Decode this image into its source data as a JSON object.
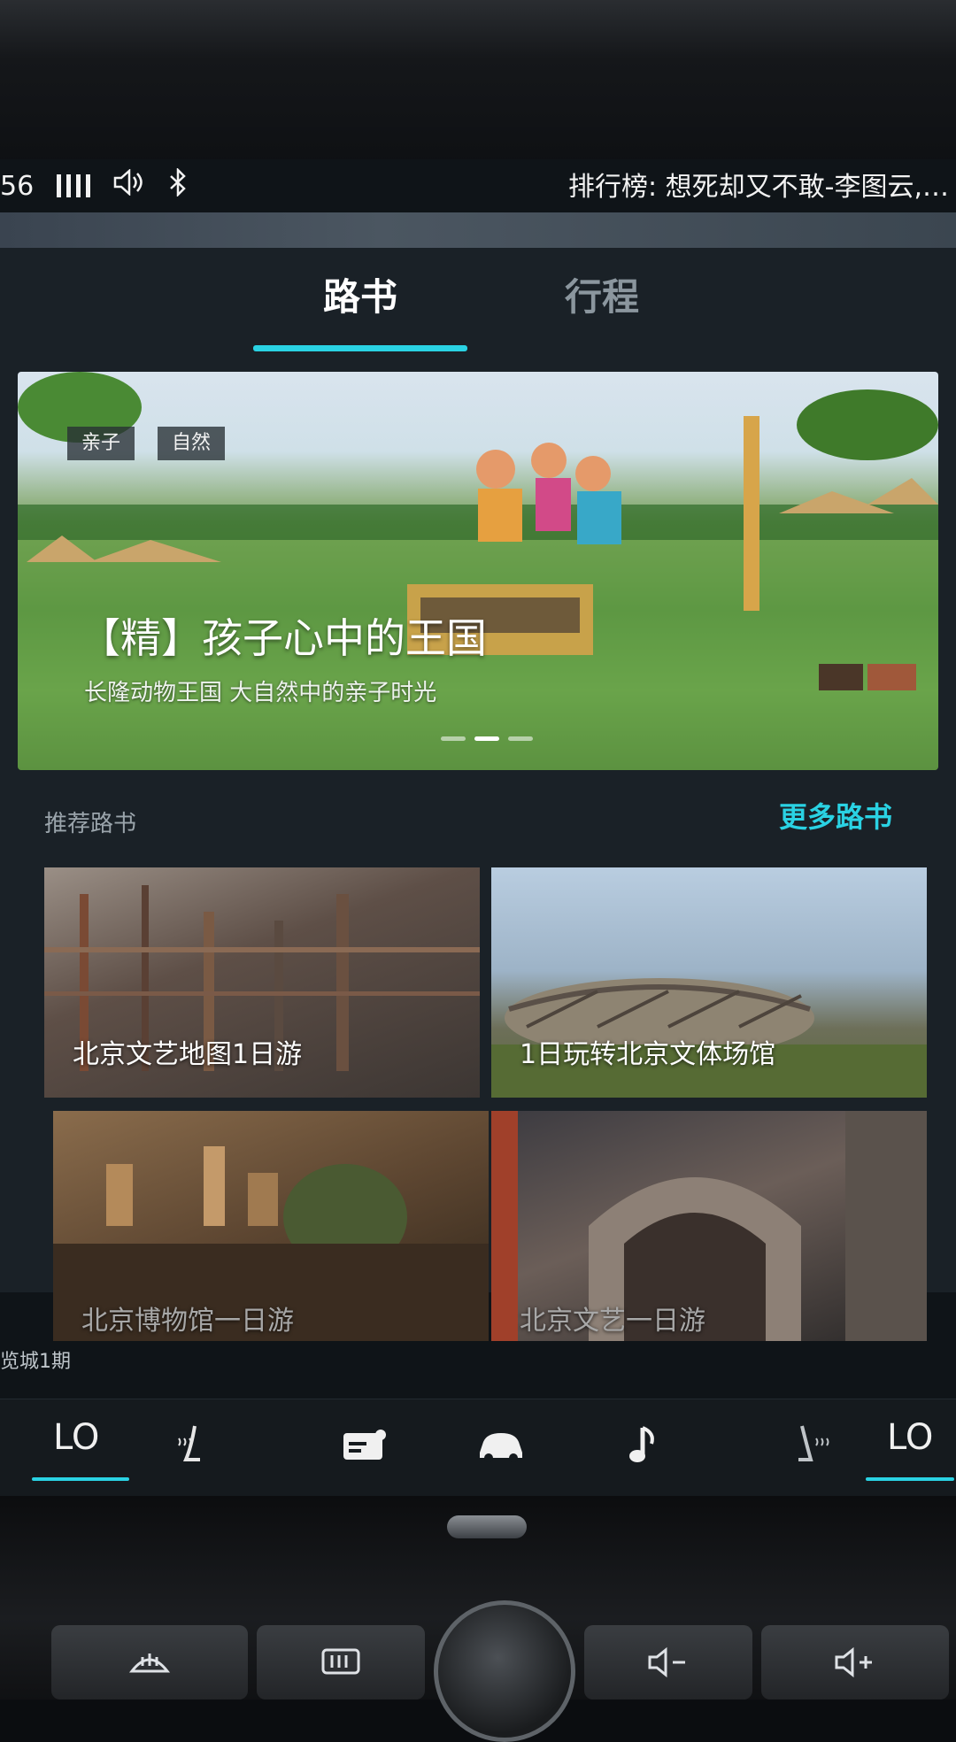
{
  "status": {
    "time_fragment": "56",
    "now_playing": "排行榜: 想死却又不敢-李图云,…"
  },
  "tabs": [
    {
      "label": "路书",
      "active": true
    },
    {
      "label": "行程",
      "active": false
    }
  ],
  "accent_color": "#2ad2e3",
  "banner": {
    "tags": [
      "亲子",
      "自然"
    ],
    "title": "【精】孩子心中的王国",
    "subtitle": "长隆动物王国 大自然中的亲子时光",
    "page_indicator": {
      "count": 3,
      "active_index": 1
    }
  },
  "recommend": {
    "label": "推荐路书",
    "more_label": "更多路书",
    "cards": [
      {
        "title": "北京文艺地图1日游"
      },
      {
        "title": "1日玩转北京文体场馆"
      },
      {
        "title": "北京博物馆一日游"
      },
      {
        "title": "北京文艺一日游"
      }
    ]
  },
  "side_caption": "览城1期",
  "dock": {
    "left_temp": "LO",
    "right_temp": "LO",
    "icons": [
      "seat-heat-left-icon",
      "card-icon",
      "car-icon",
      "music-note-icon",
      "seat-heat-right-icon"
    ]
  },
  "hardware": {
    "buttons": [
      "前除霜",
      "后除霜",
      "◁−",
      "◁+"
    ]
  }
}
